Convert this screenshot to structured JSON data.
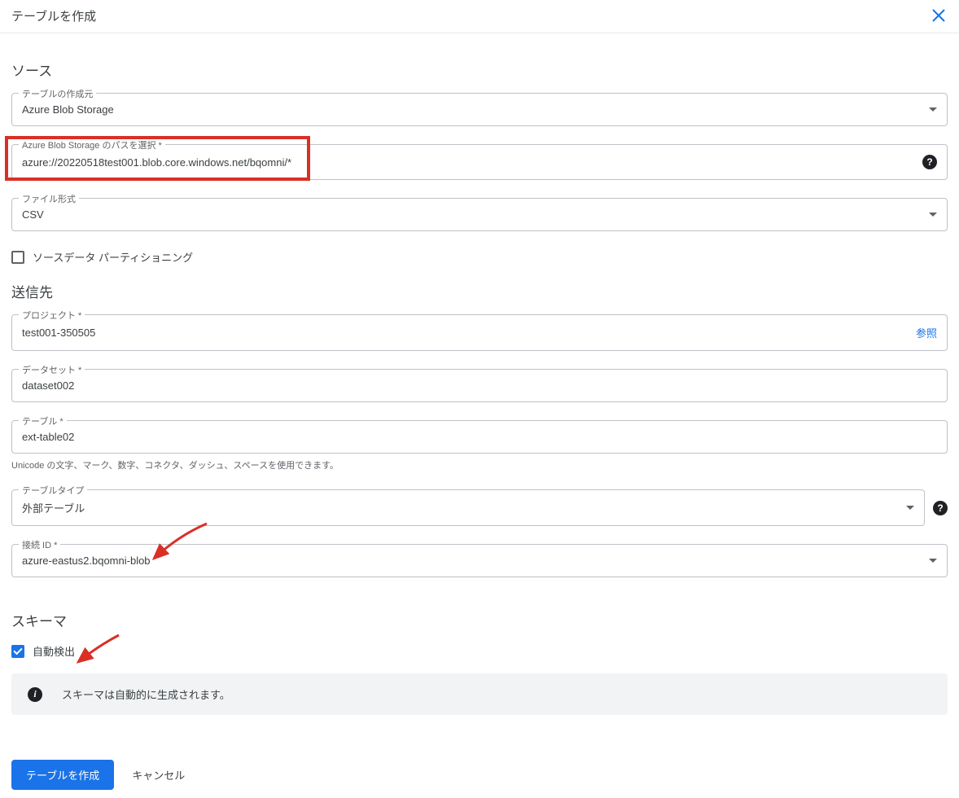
{
  "header": {
    "title": "テーブルを作成"
  },
  "sections": {
    "source": "ソース",
    "destination": "送信先",
    "schema": "スキーマ"
  },
  "source": {
    "create_from_label": "テーブルの作成元",
    "create_from_value": "Azure Blob Storage",
    "path_label": "Azure Blob Storage のパスを選択 *",
    "path_value": "azure://20220518test001.blob.core.windows.net/bqomni/*",
    "format_label": "ファイル形式",
    "format_value": "CSV",
    "partitioning_label": "ソースデータ パーティショニング"
  },
  "destination": {
    "project_label": "プロジェクト *",
    "project_value": "test001-350505",
    "project_browse": "参照",
    "dataset_label": "データセット *",
    "dataset_value": "dataset002",
    "table_label": "テーブル *",
    "table_value": "ext-table02",
    "table_helper": "Unicode の文字、マーク、数字、コネクタ、ダッシュ、スペースを使用できます。",
    "table_type_label": "テーブルタイプ",
    "table_type_value": "外部テーブル",
    "connection_label": "接続 ID *",
    "connection_value": "azure-eastus2.bqomni-blob"
  },
  "schema": {
    "auto_detect_label": "自動検出",
    "info_text": "スキーマは自動的に生成されます。"
  },
  "footer": {
    "create": "テーブルを作成",
    "cancel": "キャンセル"
  }
}
